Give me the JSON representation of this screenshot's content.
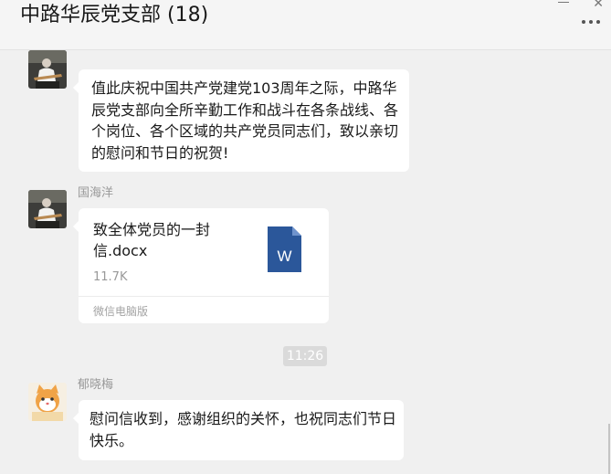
{
  "header": {
    "title": "中路华辰党支部 (18)",
    "more_icon": "more-icon"
  },
  "messages": [
    {
      "sender": "国海洋",
      "avatar": "guitar-player-photo",
      "type": "text",
      "text": "  值此庆祝中国共产党建党103周年之际，中路华辰党支部向全所辛勤工作和战斗在各条战线、各个岗位、各个区域的共产党员同志们，致以亲切的慰问和节日的祝贺!"
    },
    {
      "sender": "国海洋",
      "avatar": "guitar-player-photo",
      "type": "file",
      "file_name": "致全体党员的一封信.docx",
      "file_size": "11.7K",
      "file_icon": "word-document-icon",
      "source": "微信电脑版"
    },
    {
      "type": "time",
      "text": "11:26"
    },
    {
      "sender": "郁晓梅",
      "avatar": "cartoon-cat-avatar",
      "type": "text",
      "text": "慰问信收到，感谢组织的关怀，也祝同志们节日快乐。"
    }
  ],
  "colors": {
    "background": "#f0f0f0",
    "bubble": "#ffffff",
    "word_blue": "#2b579a",
    "meta_text": "#999999"
  }
}
